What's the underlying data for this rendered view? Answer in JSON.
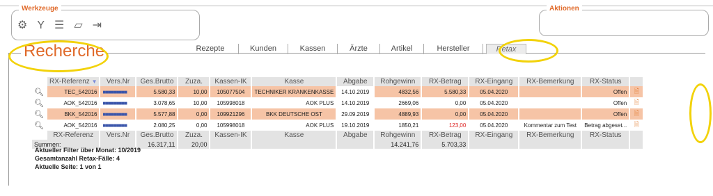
{
  "toolbox": {
    "title": "Werkzeuge",
    "icons": [
      "gears-icon",
      "filter-icon",
      "sort-down-icon",
      "eraser-icon",
      "export-icon"
    ]
  },
  "actions": {
    "title": "Aktionen"
  },
  "section": {
    "title": "Recherche"
  },
  "tabs": [
    "Rezepte",
    "Kunden",
    "Kassen",
    "Ärzte",
    "Artikel",
    "Hersteller",
    "Retax"
  ],
  "active_tab": "Retax",
  "table": {
    "columns": [
      "RX-Referenz",
      "Vers.Nr",
      "Ges.Brutto",
      "Zuza.",
      "Kassen-IK",
      "Kasse",
      "Abgabe",
      "Rohgewinn",
      "RX-Betrag",
      "RX-Eingang",
      "RX-Bemerkung",
      "RX-Status"
    ],
    "rows": [
      {
        "ref": "TEC_542016",
        "vers": "■■■■■■■■■",
        "brutto": "5.580,33",
        "zuza": "10,00",
        "ik": "105077504",
        "kasse": "TECHNIKER KRANKENKASSE",
        "abgabe": "14.10.2019",
        "roh": "4832,56",
        "betrag": "5.580,33",
        "eingang": "05.04.2020",
        "bem": "",
        "status": "Offen"
      },
      {
        "ref": "AOK_542016",
        "vers": "■■■■■■■■■",
        "brutto": "3.078,65",
        "zuza": "10,00",
        "ik": "105998018",
        "kasse": "AOK PLUS",
        "abgabe": "14.10.2019",
        "roh": "2669,06",
        "betrag": "0,00",
        "eingang": "05.04.2020",
        "bem": "",
        "status": "Offen"
      },
      {
        "ref": "BKK_542016",
        "vers": "■■■■■■■■■",
        "brutto": "5.577,88",
        "zuza": "0,00",
        "ik": "109921296",
        "kasse": "BKK DEUTSCHE OST",
        "abgabe": "29.09.2019",
        "roh": "4889,93",
        "betrag": "0,00",
        "eingang": "05.04.2020",
        "bem": "",
        "status": "Offen"
      },
      {
        "ref": "AOK_542016",
        "vers": "■■■■■■■■■",
        "brutto": "2.080,25",
        "zuza": "0,00",
        "ik": "105998018",
        "kasse": "AOK PLUS",
        "abgabe": "19.10.2019",
        "roh": "1850,21",
        "betrag": "123,00",
        "eingang": "05.04.2020",
        "bem": "Kommentar zum Test",
        "status": "Betrag abgeset..."
      }
    ],
    "sum_label": "Summen:",
    "sum_brutto": "16.317,11",
    "sum_zuza": "20,00",
    "sum_roh": "14.241,76",
    "sum_betrag": "5.703,33"
  },
  "info": {
    "filter": "Aktueller Filter über Monat: 10/2019",
    "count": "Gesamtanzahl Retax-Fälle: 4",
    "page": "Aktuelle Seite: 1 von 1"
  },
  "colors": {
    "accent": "#e06a2a",
    "row_highlight": "#f6c4a6",
    "annotation": "#f2d20a"
  }
}
